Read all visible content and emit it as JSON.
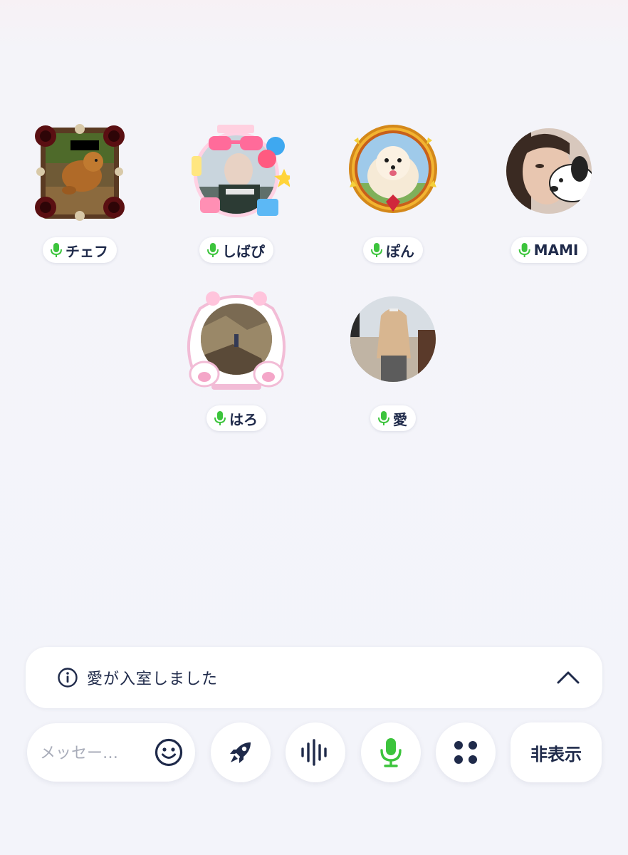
{
  "speakers": [
    {
      "name": "チェフ",
      "mic_color": "#3cc43c"
    },
    {
      "name": "しばぴ",
      "mic_color": "#3cc43c"
    },
    {
      "name": "ぽん",
      "mic_color": "#3cc43c"
    },
    {
      "name": "MAMI",
      "mic_color": "#3cc43c"
    },
    {
      "name": "はろ",
      "mic_color": "#3cc43c"
    },
    {
      "name": "愛",
      "mic_color": "#3cc43c"
    }
  ],
  "notice": {
    "text": "愛が入室しました",
    "icon": "info-icon",
    "toggle_icon": "chevron-up-icon"
  },
  "toolbar": {
    "message_placeholder": "メッセー…",
    "emoji_icon": "smiley-icon",
    "rocket_icon": "rocket-icon",
    "voice_icon": "soundwave-icon",
    "mic_icon": "mic-icon",
    "apps_icon": "four-dots-icon",
    "hide_label": "非表示"
  },
  "colors": {
    "accent_green": "#3cc43c",
    "navy": "#1f2a4a",
    "background": "#f3f4fa"
  }
}
